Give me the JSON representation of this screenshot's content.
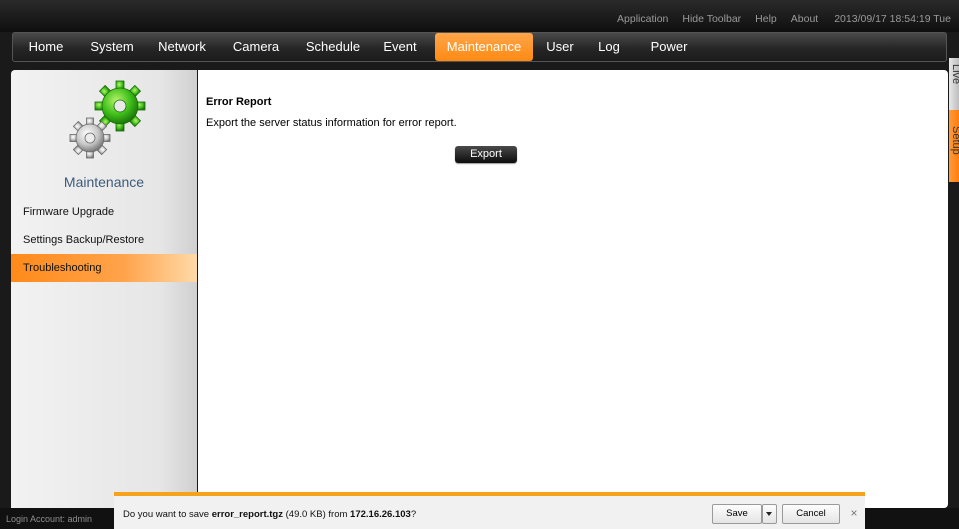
{
  "toolbar": {
    "application": "Application",
    "hide_toolbar": "Hide Toolbar",
    "help": "Help",
    "about": "About",
    "datetime": "2013/09/17 18:54:19 Tue"
  },
  "nav": {
    "items": [
      "Home",
      "System",
      "Network",
      "Camera",
      "Schedule",
      "Event",
      "Maintenance",
      "User",
      "Log",
      "Power"
    ],
    "active": "Maintenance",
    "active_color": "#ff9630"
  },
  "side_tabs": {
    "live": "Live",
    "setup": "Setup"
  },
  "sidebar": {
    "title": "Maintenance",
    "items": [
      "Firmware Upgrade",
      "Settings Backup/Restore",
      "Troubleshooting"
    ],
    "active": "Troubleshooting"
  },
  "content": {
    "title": "Error Report",
    "description": "Export the server status information for error report.",
    "export_label": "Export"
  },
  "status": {
    "login": "Login Account: admin"
  },
  "download_bar": {
    "prefix": "Do you want to save ",
    "filename": "error_report.tgz",
    "size": " (49.0 KB) from ",
    "host": "172.16.26.103",
    "suffix": "?",
    "save_label": "Save",
    "cancel_label": "Cancel",
    "close_glyph": "×"
  }
}
